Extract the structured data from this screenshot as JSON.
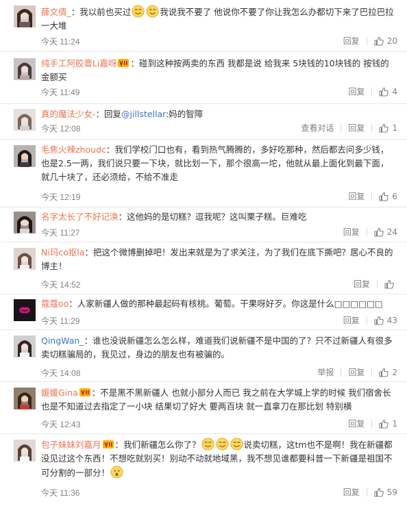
{
  "ui": {
    "reply_label": "回复",
    "view_thread_label": "查看对话",
    "report_label": "举报"
  },
  "colors": {
    "username": "#eb7350",
    "link": "#3b75c8",
    "meta": "#808080",
    "divider": "#e8e8e8"
  },
  "comments": [
    {
      "username": "薛文倩_",
      "text_before": "：我以前也买过",
      "text_after": "我说我不要了 他说你不要了你让我怎么办都切下来了巴拉巴拉一大堆",
      "emoji_count": 2,
      "time": "今天 11:24",
      "likes": "20"
    },
    {
      "username": "纯手工阿胶膏Li嘉呀",
      "text": "：碰到这种按两卖的东西 我都是说 给我来 5块钱的10块钱的 按钱的金额买",
      "time": "今天 11:49",
      "likes": "4"
    },
    {
      "username": "真的魔法少女-",
      "text_reply_prefix": "：回复",
      "mention": "@jillstellar",
      "text": ":妈的智障",
      "time": "今天 12:08",
      "likes": "1"
    },
    {
      "username": "毛焦火辣zhoudc",
      "text": "：我们学校门口也有，看到热气腾腾的，多好吃那种，然后都去问多少钱，也是2.5一两，我们说只要一下块，就比划一下，那个很高一坨，他就从最上面化到最下面，就几十块了，还必须给，不给不准走",
      "time": "今天 12:19",
      "likes": "6"
    },
    {
      "username": "名字太长了不好记涣",
      "text": "：这他妈的是切糕？逗我呢？这叫栗子糕。巨难吃",
      "time": "今天 11:27",
      "likes": "24"
    },
    {
      "username": "Ni玛co抠la",
      "text": "：把这个微博删掉吧！发出来就是为了求关注，为了我们在底下撕吧？居心不良的博主！",
      "time": "今天 14:52",
      "likes": ""
    },
    {
      "username": "蔻蔻oo",
      "text": "：人家新疆人做的那种最起码有核桃。葡萄。干果呀好歹。你这是什么□□□□□□",
      "time": "今天 11:29",
      "likes": "43"
    },
    {
      "username": "QingWan_",
      "text": "：谁也没说新疆怎么怎么样，难道我们说新疆不是中国的了？只不过新疆人有很多卖切糕骗局的，我见过，身边的朋友也有被骗的。",
      "time": "今天 14:08",
      "likes": "2"
    },
    {
      "username": "媛媛Gina",
      "text": "：不是黑不黑新疆人 也就小部分人而已 我之前在大学城上学的时候 我们宿舍长也是不知道过去指定了一小块 结果切了好大 要两百块 就一直拿刀在那比划 特别横",
      "time": "今天 12:43",
      "likes": "1"
    },
    {
      "username": "包子妹妹刘嘉月",
      "text_before": "：我们新疆怎么你了？",
      "text_after": "说卖切糕，这tm也不是啊！我在新疆都没见过这个东西！不想吃就别买！别动不动就地域黑，我不想见谁都要科普一下新疆是祖国不可分割的一部分！",
      "emoji_count": 3,
      "time": "今天 11:36",
      "likes": "59"
    }
  ]
}
